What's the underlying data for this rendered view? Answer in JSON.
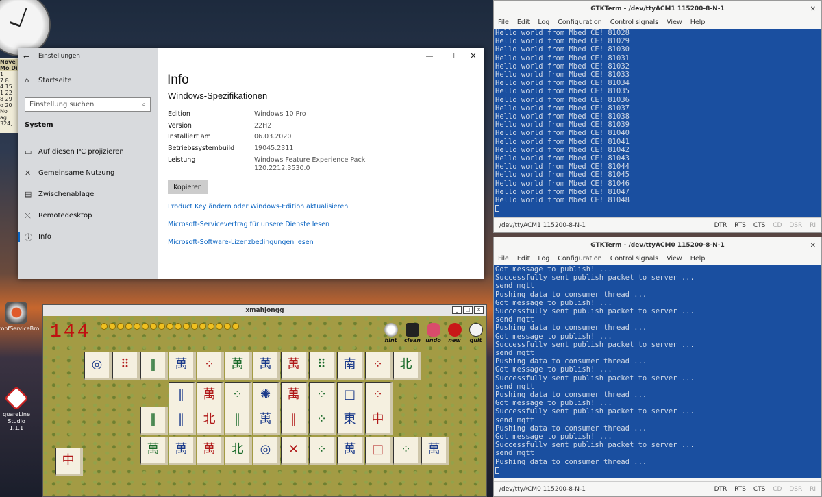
{
  "settings": {
    "title": "Einstellungen",
    "home": "Startseite",
    "search_placeholder": "Einstellung suchen",
    "section": "System",
    "nav": [
      {
        "label": "Auf diesen PC projizieren",
        "icon": "project-icon"
      },
      {
        "label": "Gemeinsame Nutzung",
        "icon": "share-icon"
      },
      {
        "label": "Zwischenablage",
        "icon": "clipboard-icon"
      },
      {
        "label": "Remotedesktop",
        "icon": "remote-icon"
      },
      {
        "label": "Info",
        "icon": "info-icon"
      }
    ],
    "page_title": "Info",
    "spec_title": "Windows-Spezifikationen",
    "specs": [
      {
        "key": "Edition",
        "value": "Windows 10 Pro"
      },
      {
        "key": "Version",
        "value": "22H2"
      },
      {
        "key": "Installiert am",
        "value": "06.03.2020"
      },
      {
        "key": "Betriebssystembuild",
        "value": "19045.2311"
      },
      {
        "key": "Leistung",
        "value": "Windows Feature Experience Pack",
        "value2": "120.2212.3530.0"
      }
    ],
    "copy_label": "Kopieren",
    "links": [
      "Product Key ändern oder Windows-Edition aktualisieren",
      "Microsoft-Servicevertrag für unsere Dienste lesen",
      "Microsoft-Software-Lizenzbedingungen lesen"
    ]
  },
  "term1": {
    "title": "GTKTerm - /dev/ttyACM1  115200-8-N-1",
    "menu": [
      "File",
      "Edit",
      "Log",
      "Configuration",
      "Control signals",
      "View",
      "Help"
    ],
    "lines": [
      "Hello world from Mbed CE! 81028",
      "Hello world from Mbed CE! 81029",
      "Hello world from Mbed CE! 81030",
      "Hello world from Mbed CE! 81031",
      "Hello world from Mbed CE! 81032",
      "Hello world from Mbed CE! 81033",
      "Hello world from Mbed CE! 81034",
      "Hello world from Mbed CE! 81035",
      "Hello world from Mbed CE! 81036",
      "Hello world from Mbed CE! 81037",
      "Hello world from Mbed CE! 81038",
      "Hello world from Mbed CE! 81039",
      "Hello world from Mbed CE! 81040",
      "Hello world from Mbed CE! 81041",
      "Hello world from Mbed CE! 81042",
      "Hello world from Mbed CE! 81043",
      "Hello world from Mbed CE! 81044",
      "Hello world from Mbed CE! 81045",
      "Hello world from Mbed CE! 81046",
      "Hello world from Mbed CE! 81047",
      "Hello world from Mbed CE! 81048"
    ],
    "status_port": "/dev/ttyACM1  115200-8-N-1",
    "signals": [
      "DTR",
      "RTS",
      "CTS",
      "CD",
      "DSR",
      "RI"
    ]
  },
  "term2": {
    "title": "GTKTerm - /dev/ttyACM0  115200-8-N-1",
    "menu": [
      "File",
      "Edit",
      "Log",
      "Configuration",
      "Control signals",
      "View",
      "Help"
    ],
    "lines": [
      "Got message to publish! ...",
      "Successfully sent publish packet to server ...",
      "send mqtt",
      "Pushing data to consumer thread ...",
      "Got message to publish! ...",
      "Successfully sent publish packet to server ...",
      "send mqtt",
      "Pushing data to consumer thread ...",
      "Got message to publish! ...",
      "Successfully sent publish packet to server ...",
      "send mqtt",
      "Pushing data to consumer thread ...",
      "Got message to publish! ...",
      "Successfully sent publish packet to server ...",
      "send mqtt",
      "Pushing data to consumer thread ...",
      "Got message to publish! ...",
      "Successfully sent publish packet to server ...",
      "send mqtt",
      "Pushing data to consumer thread ...",
      "Got message to publish! ...",
      "Successfully sent publish packet to server ...",
      "send mqtt",
      "Pushing data to consumer thread ..."
    ],
    "status_port": "/dev/ttyACM0  115200-8-N-1",
    "signals": [
      "DTR",
      "RTS",
      "CTS",
      "CD",
      "DSR",
      "RI"
    ]
  },
  "mahjongg": {
    "title": "xmahjongg",
    "tiles_left": "144",
    "tools": [
      "hint",
      "clean",
      "undo",
      "new",
      "quit"
    ]
  },
  "desktop": {
    "icon1_label": "econfServiceBro...",
    "icon2_label": "quareLine Studio",
    "icon2_sub": "1.1.1",
    "cal_month": "Nove",
    "cal_head": "Mo Di",
    "cal_rows": [
      "1",
      "7 8",
      "4 15",
      "1 22",
      "8 29",
      "",
      "o 20 No",
      "ag 324,"
    ]
  }
}
